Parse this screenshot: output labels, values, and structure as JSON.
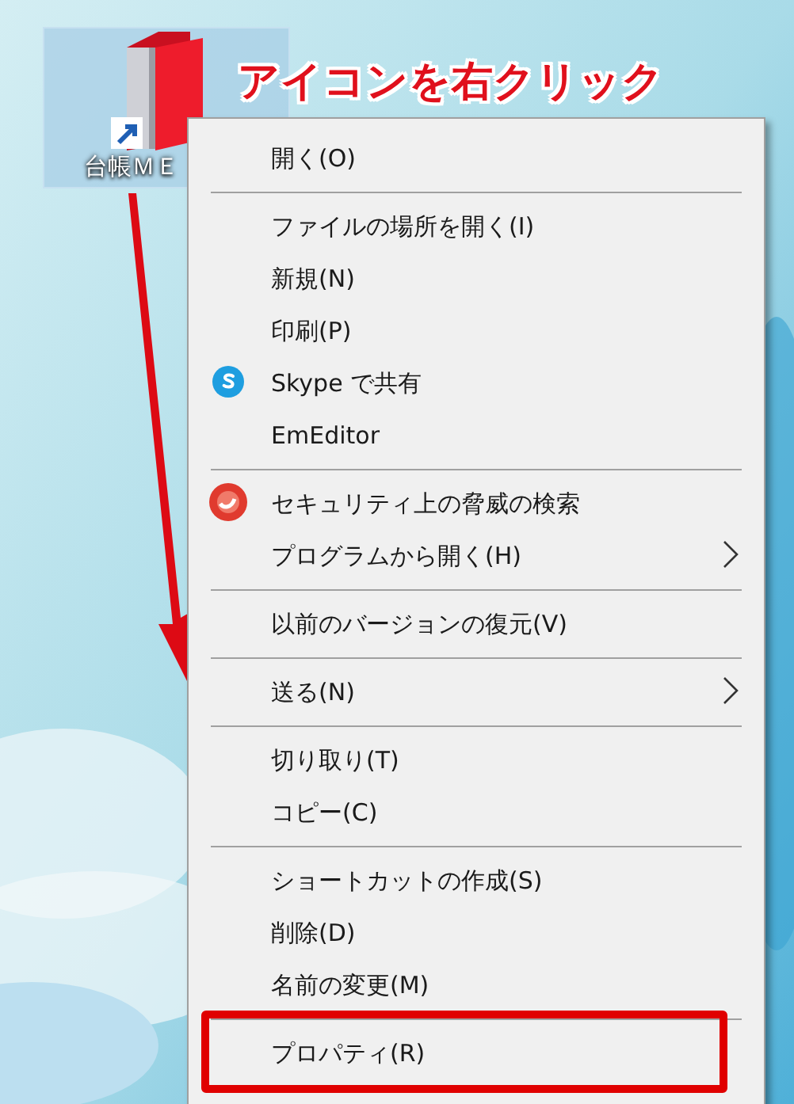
{
  "desktop_icon": {
    "label": "台帳ＭＥ",
    "selected": true
  },
  "annotation": "アイコンを右クリック",
  "context_menu": {
    "groups": [
      {
        "items": [
          {
            "label": "開く(O)",
            "kind": "plain",
            "submenu": false,
            "annotated": false
          }
        ]
      },
      {
        "items": [
          {
            "label": "ファイルの場所を開く(I)",
            "kind": "plain",
            "submenu": false,
            "annotated": false
          },
          {
            "label": "新規(N)",
            "kind": "plain",
            "submenu": false,
            "annotated": false
          },
          {
            "label": "印刷(P)",
            "kind": "plain",
            "submenu": false,
            "annotated": false
          },
          {
            "label": "Skype で共有",
            "kind": "skype",
            "submenu": false,
            "annotated": false
          },
          {
            "label": "EmEditor",
            "kind": "plain",
            "submenu": false,
            "annotated": false
          }
        ]
      },
      {
        "items": [
          {
            "label": "セキュリティ上の脅威の検索",
            "kind": "security",
            "submenu": false,
            "annotated": false
          },
          {
            "label": "プログラムから開く(H)",
            "kind": "plain",
            "submenu": true,
            "annotated": false
          }
        ]
      },
      {
        "items": [
          {
            "label": "以前のバージョンの復元(V)",
            "kind": "plain",
            "submenu": false,
            "annotated": false
          }
        ]
      },
      {
        "items": [
          {
            "label": "送る(N)",
            "kind": "plain",
            "submenu": true,
            "annotated": false
          }
        ]
      },
      {
        "items": [
          {
            "label": "切り取り(T)",
            "kind": "plain",
            "submenu": false,
            "annotated": false
          },
          {
            "label": "コピー(C)",
            "kind": "plain",
            "submenu": false,
            "annotated": false
          }
        ]
      },
      {
        "items": [
          {
            "label": "ショートカットの作成(S)",
            "kind": "plain",
            "submenu": false,
            "annotated": false
          },
          {
            "label": "削除(D)",
            "kind": "plain",
            "submenu": false,
            "annotated": false
          },
          {
            "label": "名前の変更(M)",
            "kind": "plain",
            "submenu": false,
            "annotated": false
          }
        ]
      },
      {
        "items": [
          {
            "label": "プロパティ(R)",
            "kind": "plain",
            "submenu": false,
            "annotated": true
          }
        ]
      }
    ]
  }
}
